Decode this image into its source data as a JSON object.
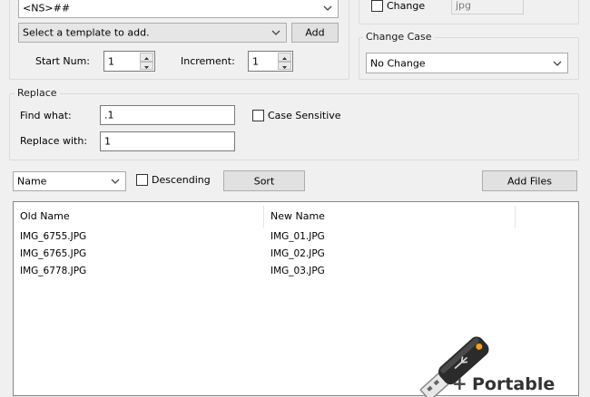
{
  "template": {
    "value": "<NS>##",
    "add_select": "Select a template to add.",
    "add_button": "Add",
    "start_num_label": "Start Num:",
    "start_num_value": "1",
    "increment_label": "Increment:",
    "increment_value": "1"
  },
  "extension": {
    "change_label": "Change",
    "change_checked": false,
    "ext_value": "jpg"
  },
  "change_case": {
    "legend": "Change Case",
    "value": "No Change"
  },
  "replace": {
    "legend": "Replace",
    "find_label": "Find what:",
    "find_value": ".1",
    "case_label": "Case Sensitive",
    "case_checked": false,
    "replace_label": "Replace with:",
    "replace_value": "1"
  },
  "sort": {
    "field": "Name",
    "descending_label": "Descending",
    "descending_checked": false,
    "sort_button": "Sort",
    "add_files_button": "Add Files"
  },
  "file_list": {
    "columns": [
      "Old Name",
      "New Name"
    ],
    "rows": [
      {
        "old": "IMG_6755.JPG",
        "new": "IMG_01.JPG"
      },
      {
        "old": "IMG_6765.JPG",
        "new": "IMG_02.JPG"
      },
      {
        "old": "IMG_6778.JPG",
        "new": "IMG_03.JPG"
      }
    ]
  },
  "watermark": {
    "plus": "+",
    "text": "Portable",
    "icon": "usb-drive-icon"
  }
}
